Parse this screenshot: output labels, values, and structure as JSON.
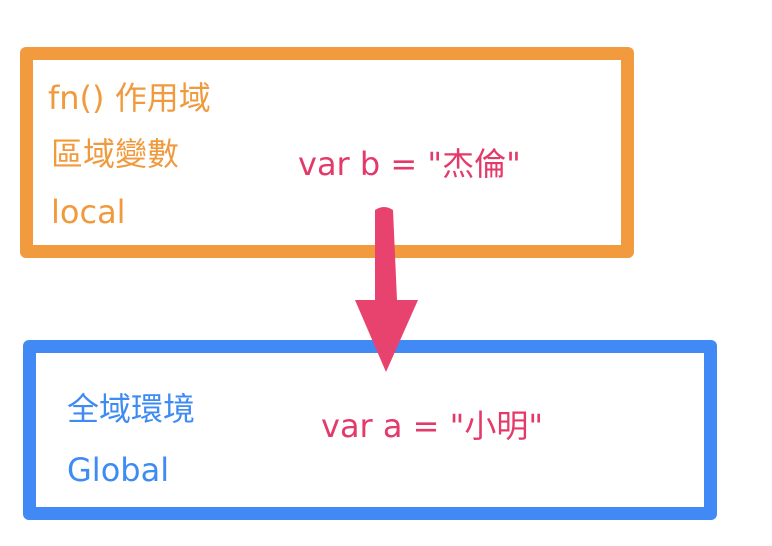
{
  "local_scope": {
    "title": "fn() 作用域",
    "label_zh": "區域變數",
    "label_en": "local",
    "declaration": "var b = \"杰倫\""
  },
  "global_scope": {
    "label_zh": "全域環境",
    "label_en": "Global",
    "declaration": "var a = \"小明\""
  },
  "colors": {
    "local_border": "#f19a3e",
    "global_border": "#418af5",
    "code_text": "#e33a6a",
    "arrow": "#e8426e"
  }
}
